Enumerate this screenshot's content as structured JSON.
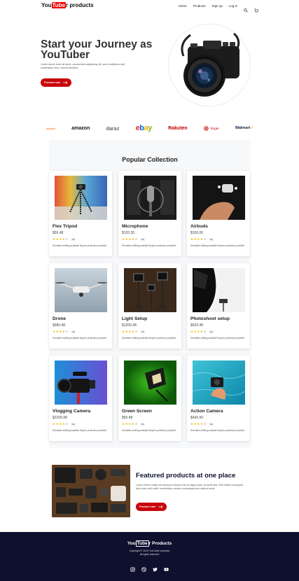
{
  "nav": {
    "logo_pre": "You",
    "logo_tube": "Tube",
    "logo_post": "r products",
    "links": [
      "Home",
      "Products",
      "Sign up",
      "Log in"
    ],
    "icons": [
      "search-icon",
      "cart-icon"
    ]
  },
  "hero": {
    "title": "Start your Journey as YouTuber",
    "text": "Lorem ipsum dolor sit amet, consectetur adipiscing elit, sem vestibulum sed scelerisque eros, viverra faucibus.",
    "button": "Product now"
  },
  "brands": [
    "alibaba",
    "amazon",
    "daraz",
    "ebay",
    "Rakuten",
    "Target",
    "Walmart"
  ],
  "collection": {
    "title": "Popular Collection",
    "products": [
      {
        "name": "Flex Tripod",
        "price": "$50.48",
        "rating": 4,
        "count": "14",
        "desc": "Shortable shifting available Buyers protection possible!"
      },
      {
        "name": "Microphone",
        "price": "$120.35",
        "rating": 4,
        "count": "13",
        "desc": "Shortable shifting available Buyers protection possible!"
      },
      {
        "name": "Airbuds",
        "price": "$100.00",
        "rating": 4,
        "count": "14",
        "desc": "Shortable shifting available Buyers protection possible!"
      },
      {
        "name": "Drone",
        "price": "$980.48",
        "rating": 4,
        "count": "14",
        "desc": "Shortable shifting available Buyers protection possible!"
      },
      {
        "name": "Light Setup",
        "price": "$1200.48",
        "rating": 4,
        "count": "10",
        "desc": "Shortable shifting available Buyers protection possible!"
      },
      {
        "name": "Photoshoot setup",
        "price": "$520.48",
        "rating": 4,
        "count": "14",
        "desc": "Shortable shifting available Buyers protection possible!"
      },
      {
        "name": "Vlogging Camera",
        "price": "$2200.98",
        "rating": 4,
        "count": "14",
        "desc": "Shortable shifting available Buyers protection possible!"
      },
      {
        "name": "Green Screen",
        "price": "$50.48",
        "rating": 4,
        "count": "10",
        "desc": "Shortable shifting available Buyers protection possible!"
      },
      {
        "name": "Action Camera",
        "price": "$430.00",
        "rating": 4,
        "count": "14",
        "desc": "Shortable shifting available Buyers protection possible!"
      }
    ]
  },
  "featured": {
    "title": "Featured products at one place",
    "text": "Lorem minim mollit non deserunt ullamco est sit aliqua dolor do amet sint. Velit officia consequat duis enim velit mollit. exercitation veniam consequat sunt nostrud amet.",
    "button": "Product now"
  },
  "footer": {
    "logo_pre": "You",
    "logo_tube": "Tube",
    "logo_post": "r Products",
    "copyright": "Copyright © 2023 YouTuber products",
    "rights": "all rights reserved",
    "social": [
      "instagram-icon",
      "dribbble-icon",
      "twitter-icon",
      "youtube-icon"
    ]
  },
  "colors": {
    "brand_red": "#c8050b",
    "footer_bg": "#0f0f2e",
    "star": "#f0b400"
  }
}
